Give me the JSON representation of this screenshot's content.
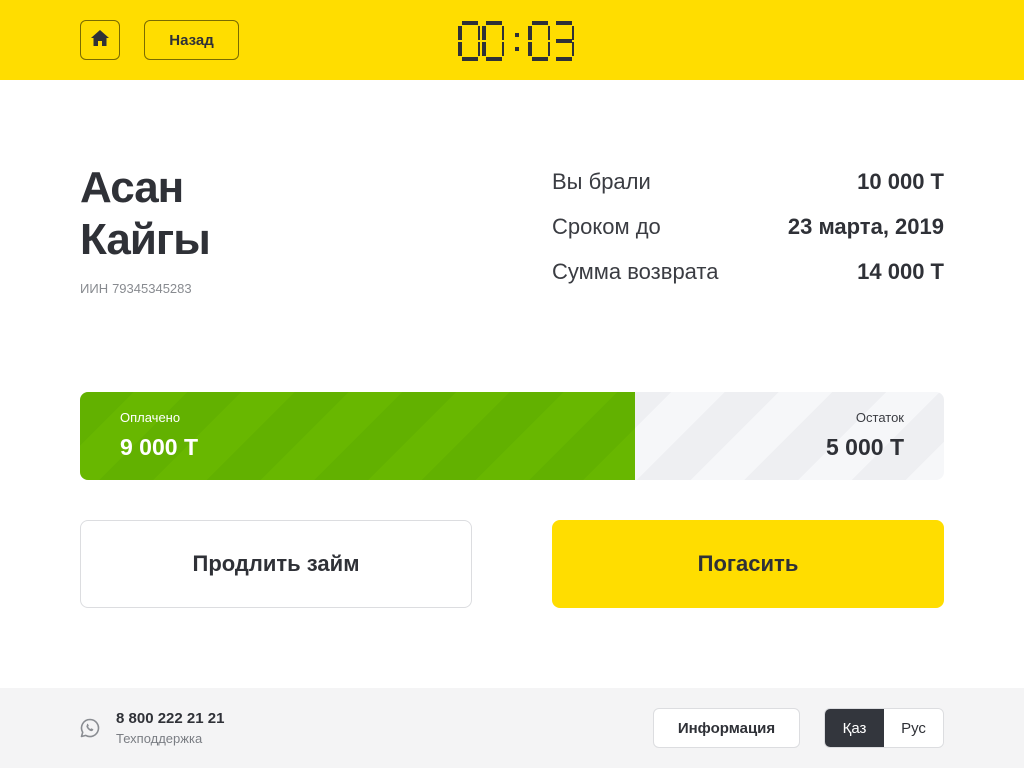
{
  "header": {
    "home_icon": "home-icon",
    "back_label": "Назад",
    "timer": "00:03",
    "background_color": "#ffdd00"
  },
  "client": {
    "first_name": "Асан",
    "last_name": "Кайгы",
    "iin_label": "ИИН",
    "iin_value": "79345345283"
  },
  "loan": {
    "rows": [
      {
        "label": "Вы брали",
        "value": "10 000 Т"
      },
      {
        "label": "Сроком до",
        "value": "23 марта, 2019"
      },
      {
        "label": "Сумма возврата",
        "value": "14 000 Т"
      }
    ]
  },
  "progress": {
    "paid_label": "Оплачено",
    "paid_value": "9 000 Т",
    "remaining_label": "Остаток",
    "remaining_value": "5 000 Т",
    "paid_amount": 9000,
    "remaining_amount": 5000,
    "paid_color": "#64b300"
  },
  "actions": {
    "extend_label": "Продлить займ",
    "pay_label": "Погасить",
    "pay_color": "#ffdd00"
  },
  "footer": {
    "support_icon": "whatsapp-icon",
    "phone": "8 800 222 21 21",
    "support_label": "Техподдержка",
    "info_label": "Информация",
    "languages": [
      {
        "label": "Қаз",
        "active": true
      },
      {
        "label": "Рус",
        "active": false
      }
    ]
  }
}
